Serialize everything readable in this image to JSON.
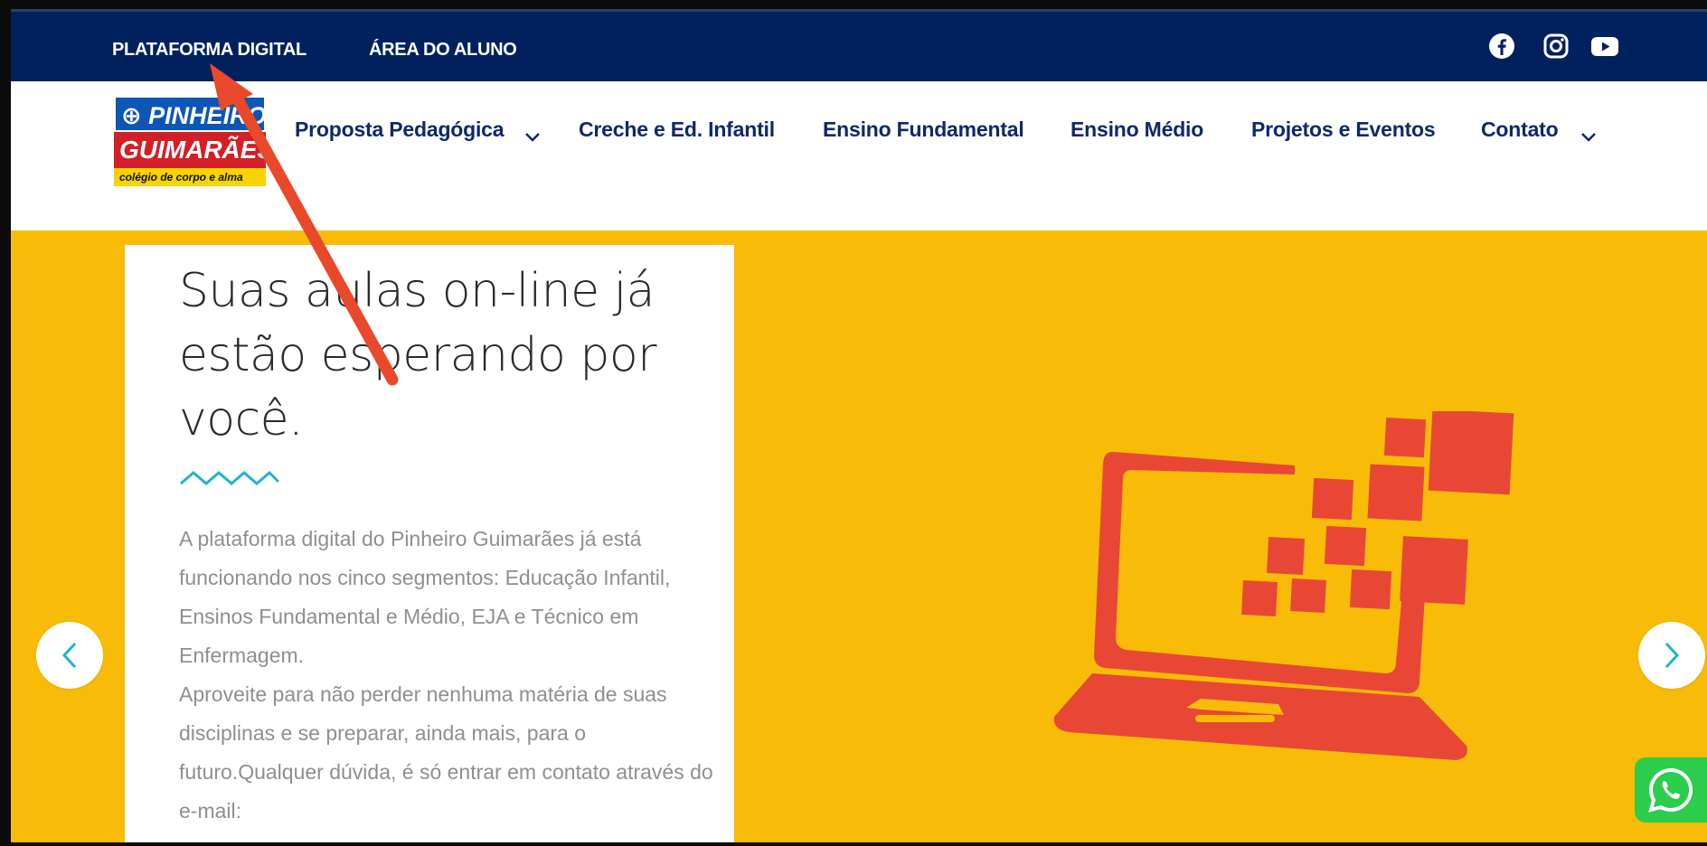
{
  "topbar": {
    "links": [
      "PLATAFORMA DIGITAL",
      "ÁREA DO ALUNO"
    ],
    "social_icons": [
      "facebook-icon",
      "instagram-icon",
      "youtube-icon"
    ]
  },
  "logo": {
    "line1": "PINHEIRO",
    "line2": "GUIMARÃES",
    "tagline": "colégio de corpo e alma"
  },
  "nav": {
    "items": [
      {
        "label": "Proposta Pedagógica",
        "has_dropdown": true
      },
      {
        "label": "Creche e Ed. Infantil",
        "has_dropdown": false
      },
      {
        "label": "Ensino Fundamental",
        "has_dropdown": false
      },
      {
        "label": "Ensino Médio",
        "has_dropdown": false
      },
      {
        "label": "Projetos e Eventos",
        "has_dropdown": false
      },
      {
        "label": "Contato",
        "has_dropdown": true
      }
    ]
  },
  "hero": {
    "headline": "Suas aulas on-line já estão esperando por você.",
    "paragraph1": "A plataforma digital do Pinheiro Guimarães já está funcionando nos cinco segmentos: Educação Infantil, Ensinos Fundamental e Médio, EJA e Técnico em Enfermagem.",
    "paragraph2": "Aproveite para não perder nenhuma matéria de suas disciplinas e se preparar, ainda mais, para o futuro.Qualquer dúvida, é só entrar em contato através do e-mail:"
  },
  "colors": {
    "topbar_bg": "#01215e",
    "nav_text": "#10276b",
    "hero_bg": "#f8bb07",
    "laptop": "#e84736",
    "accent_teal": "#1fb4c8",
    "annotation_arrow": "#e8492a",
    "whatsapp": "#2ccc4c"
  },
  "icons": {
    "slider_prev": "chevron-left-icon",
    "slider_next": "chevron-right-icon",
    "whatsapp": "whatsapp-icon"
  }
}
